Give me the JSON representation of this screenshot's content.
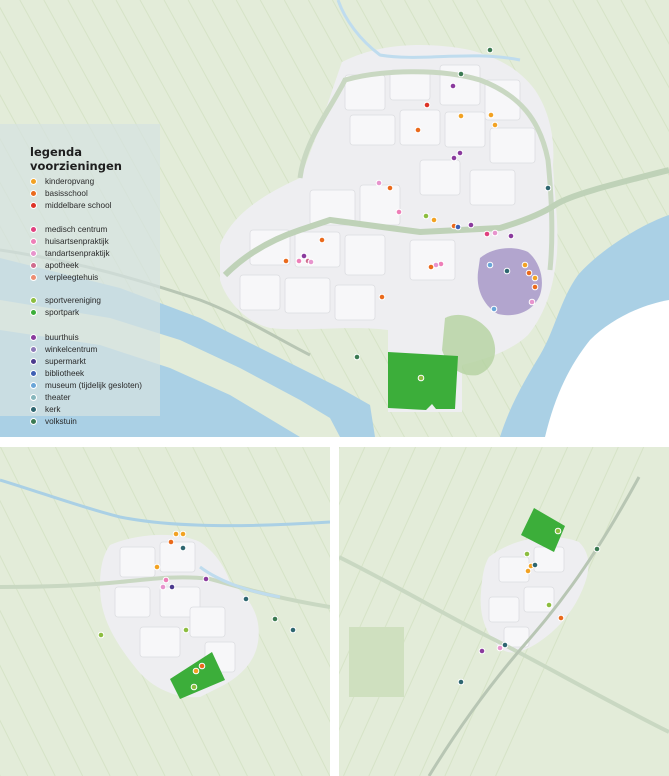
{
  "legend": {
    "title": "legenda voorzieningen",
    "groups": [
      {
        "items": [
          {
            "label": "kinderopvang",
            "color": "#f2a223"
          },
          {
            "label": "basisschool",
            "color": "#ea6a1c"
          },
          {
            "label": "middelbare school",
            "color": "#dd3327"
          }
        ]
      },
      {
        "items": [
          {
            "label": "medisch centrum",
            "color": "#e0417f"
          },
          {
            "label": "huisartsenpraktijk",
            "color": "#ee7fb8"
          },
          {
            "label": "tandartsenpraktijk",
            "color": "#e794cd"
          },
          {
            "label": "apotheek",
            "color": "#cf6d8e"
          },
          {
            "label": "verpleegtehuis",
            "color": "#ec8d72"
          }
        ]
      },
      {
        "items": [
          {
            "label": "sportvereniging",
            "color": "#8cbd3f"
          },
          {
            "label": "sportpark",
            "color": "#3cae3a"
          }
        ]
      },
      {
        "items": [
          {
            "label": "buurthuis",
            "color": "#8a3a9d"
          },
          {
            "label": "winkelcentrum",
            "color": "#8c7ab8"
          },
          {
            "label": "supermarkt",
            "color": "#4b3a8e"
          },
          {
            "label": "bibliotheek",
            "color": "#3e5fb4"
          },
          {
            "label": "museum (tijdelijk gesloten)",
            "color": "#6aa5d8"
          },
          {
            "label": "theater",
            "color": "#86b6bc"
          },
          {
            "label": "kerk",
            "color": "#2e6670"
          },
          {
            "label": "volkstuin",
            "color": "#3b7a52"
          }
        ]
      }
    ]
  },
  "colors": {
    "meadow": "#e3ecd9",
    "meadow_stripe": "#d7e4c8",
    "urban": "#eeeef1",
    "block": "#f7f7f9",
    "street": "#d9dade",
    "water": "#aad0e5",
    "canal": "#bfdcee",
    "road": "#c9d8c2",
    "green": "#b4d2a0",
    "shopping": "#a798c8",
    "sportpark_fill": "#3cae3a"
  }
}
